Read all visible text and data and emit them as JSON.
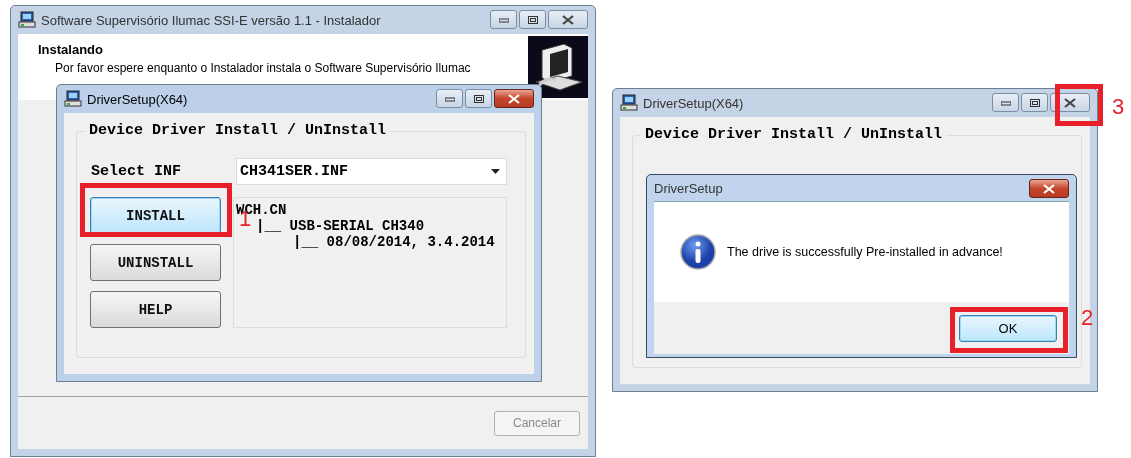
{
  "installer": {
    "title": "Software Supervisório Ilumac SSI-E versão 1.1 - Instalador",
    "active": false,
    "heading": "Instalando",
    "subtitle": "Por favor espere enquanto o Instalador instala o Software Supervisório Ilumac",
    "cancel_button": {
      "label": "Cancelar",
      "disabled": true
    }
  },
  "driver_windows": [
    {
      "title": "DriverSetup(X64)",
      "active": true,
      "group_title": "Device Driver Install / UnInstall",
      "select_label": "Select INF",
      "inf_value": "CH341SER.INF",
      "buttons": [
        {
          "label": "INSTALL",
          "focused": true
        },
        {
          "label": "UNINSTALL",
          "focused": false
        },
        {
          "label": "HELP",
          "focused": false
        }
      ],
      "info_tree": [
        {
          "text": "WCH.CN",
          "children": [
            {
              "text": "|__ USB-SERIAL CH340",
              "children": [
                {
                  "text": "|__ 08/08/2014, 3.4.2014"
                }
              ]
            }
          ]
        }
      ]
    },
    {
      "title": "DriverSetup(X64)",
      "active": false,
      "group_title": "Device Driver Install / UnInstall"
    }
  ],
  "message_box": {
    "title": "DriverSetup",
    "message": "The drive is successfully Pre-installed in advance!",
    "ok_button": {
      "label": "OK",
      "focused": true
    }
  },
  "annotations": [
    {
      "label": "1"
    },
    {
      "label": "2"
    },
    {
      "label": "3"
    }
  ]
}
